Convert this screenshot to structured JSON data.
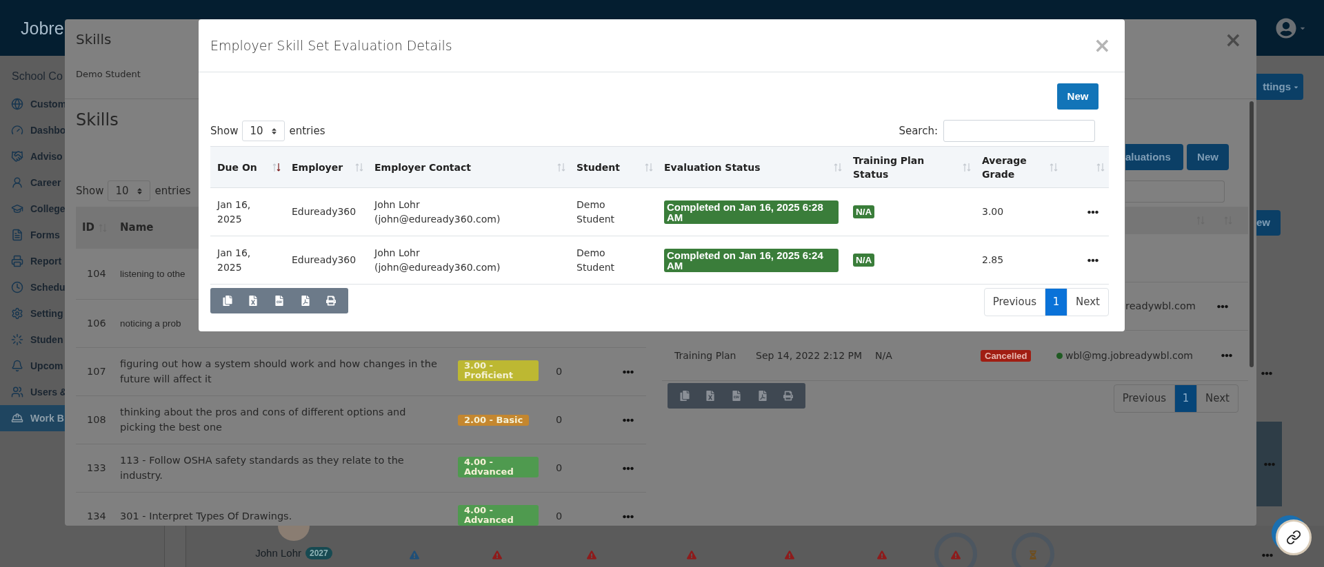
{
  "app_header": {
    "logo": "Jobre"
  },
  "sidebar": {
    "title": "School Co",
    "items": [
      {
        "label": "Custom",
        "selected": false
      },
      {
        "label": "Dashbo",
        "selected": false
      },
      {
        "label": "Adviso",
        "selected": false
      },
      {
        "label": "Career",
        "selected": false
      },
      {
        "label": "College",
        "selected": false
      },
      {
        "label": "Forms",
        "selected": false
      },
      {
        "label": "Report",
        "selected": false
      },
      {
        "label": "Schedu",
        "selected": false
      },
      {
        "label": "Setting",
        "selected": false
      },
      {
        "label": "Studen",
        "selected": false
      },
      {
        "label": "Upcom",
        "selected": false
      },
      {
        "label": "Users &",
        "selected": false
      },
      {
        "label": "Work B",
        "selected": true
      }
    ]
  },
  "background": {
    "settings_button": "ttings",
    "new_button": "ew",
    "person": {
      "name": "John Lohr",
      "badge": "2027"
    }
  },
  "skills_modal": {
    "title": "Skills",
    "subtitle": "Demo Student",
    "close": "×",
    "skills": {
      "heading": "Skills",
      "show_label": "Show",
      "page_size": "10",
      "entries_label": "entries",
      "columns": [
        "ID",
        "Name"
      ],
      "rows": [
        {
          "id": "104",
          "name": "listening to othe"
        },
        {
          "id": "106",
          "name": "noticing a prob"
        },
        {
          "id": "107",
          "name": "figuring out how a system should work and how changes in the future will affect it",
          "grade": {
            "label": "3.00 - Proficient",
            "color": "#bdb832"
          },
          "count": "0"
        },
        {
          "id": "108",
          "name": "thinking about the pros and cons of different options and picking the best one",
          "grade": {
            "label": "2.00 - Basic",
            "color": "#c4872f"
          },
          "count": "0"
        },
        {
          "id": "133",
          "name": "113 - Follow OSHA safety standards as they relate to the industry.",
          "grade": {
            "label": "4.00 - Advanced",
            "color": "#4f9a4f"
          },
          "count": "0"
        },
        {
          "id": "134",
          "name": "301 - Interpret Types Of Drawings.",
          "grade": {
            "label": "4.00 - Advanced",
            "color": "#4f9a4f"
          },
          "count": "0"
        }
      ]
    },
    "evaluations": {
      "evaluations_button": "aluations",
      "new_button": "New",
      "rows": [
        {
          "email": "readywbl.com"
        },
        {
          "type": "Training Plan",
          "date": "Sep 14, 2022 2:12 PM",
          "plan_status": "N/A",
          "status": "Cancelled",
          "email": "wbl@mg.jobreadywbl.com"
        }
      ],
      "pagination": {
        "previous": "Previous",
        "pages": [
          {
            "label": "1",
            "selected": true
          }
        ],
        "next": "Next"
      }
    }
  },
  "evaluation_modal": {
    "title": "Employer Skill Set Evaluation Details",
    "close": "×",
    "new_button": "New",
    "show_label": "Show",
    "page_size": "10",
    "entries_label": "entries",
    "search_label": "Search:",
    "columns": [
      {
        "label": "Due On",
        "sorted": true
      },
      {
        "label": "Employer",
        "sorted": false
      },
      {
        "label": "Employer Contact",
        "sorted": false
      },
      {
        "label": "Student",
        "sorted": false
      },
      {
        "label": "Evaluation Status",
        "sorted": false
      },
      {
        "label": "Training Plan Status",
        "sorted": false
      },
      {
        "label": "Average Grade",
        "sorted": false
      }
    ],
    "rows": [
      {
        "due_on": "Jan 16, 2025",
        "employer": "Eduready360",
        "contact": "John Lohr (john@eduready360.com)",
        "student": "Demo Student",
        "evaluation_status": "Completed on Jan 16, 2025 6:28 AM",
        "training_plan_status": "N/A",
        "average_grade": "3.00"
      },
      {
        "due_on": "Jan 16, 2025",
        "employer": "Eduready360",
        "contact": "John Lohr (john@eduready360.com)",
        "student": "Demo Student",
        "evaluation_status": "Completed on Jan 16, 2025 6:24 AM",
        "training_plan_status": "N/A",
        "average_grade": "2.85"
      }
    ],
    "pagination": {
      "previous": "Previous",
      "pages": [
        {
          "label": "1",
          "selected": true
        }
      ],
      "next": "Next"
    }
  }
}
